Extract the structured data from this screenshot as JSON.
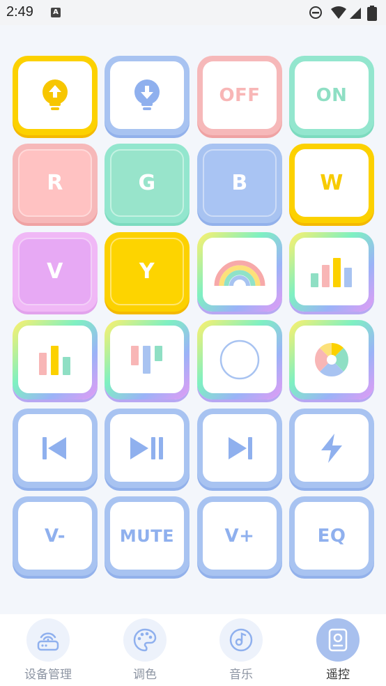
{
  "status_bar": {
    "time": "2:49",
    "app_icon_letter": "A"
  },
  "pads": {
    "bright_up": {
      "icon": "bulb-up-icon",
      "color": "#f7c600"
    },
    "bright_down": {
      "icon": "bulb-down-icon",
      "color": "#8fb0ee"
    },
    "off": {
      "label": "OFF"
    },
    "on": {
      "label": "ON"
    },
    "r": {
      "label": "R"
    },
    "g": {
      "label": "G"
    },
    "b": {
      "label": "B"
    },
    "w": {
      "label": "W"
    },
    "v": {
      "label": "V"
    },
    "y": {
      "label": "Y"
    },
    "rainbow": {
      "icon": "rainbow-icon"
    },
    "bars_4": {
      "icon": "bar-chart-icon"
    },
    "bars_3": {
      "icon": "bar-chart-3-icon"
    },
    "bars_hanging": {
      "icon": "bar-hanging-icon"
    },
    "circle": {
      "icon": "circle-icon"
    },
    "wheel": {
      "icon": "color-wheel-icon"
    },
    "prev": {
      "icon": "previous-track-icon"
    },
    "play_pause": {
      "icon": "play-pause-icon"
    },
    "next": {
      "icon": "next-track-icon"
    },
    "flash": {
      "icon": "lightning-icon"
    },
    "vol_down": {
      "label": "V-"
    },
    "mute": {
      "label": "MUTE"
    },
    "vol_up": {
      "label": "V+"
    },
    "eq": {
      "label": "EQ"
    }
  },
  "colors": {
    "yellow": "#fcd100",
    "blue": "#a8c3f1",
    "pink": "#f6b8b9",
    "mint": "#93e6ce",
    "red_fill": "#ffc2c2",
    "green_fill": "#98e4cb",
    "blue_fill": "#a9c4f3",
    "violet_fill": "#e7a9f4"
  },
  "tabs": [
    {
      "label": "设备管理",
      "icon": "router-icon",
      "active": false
    },
    {
      "label": "调色",
      "icon": "palette-icon",
      "active": false
    },
    {
      "label": "音乐",
      "icon": "music-disc-icon",
      "active": false
    },
    {
      "label": "遥控",
      "icon": "remote-icon",
      "active": true
    }
  ]
}
